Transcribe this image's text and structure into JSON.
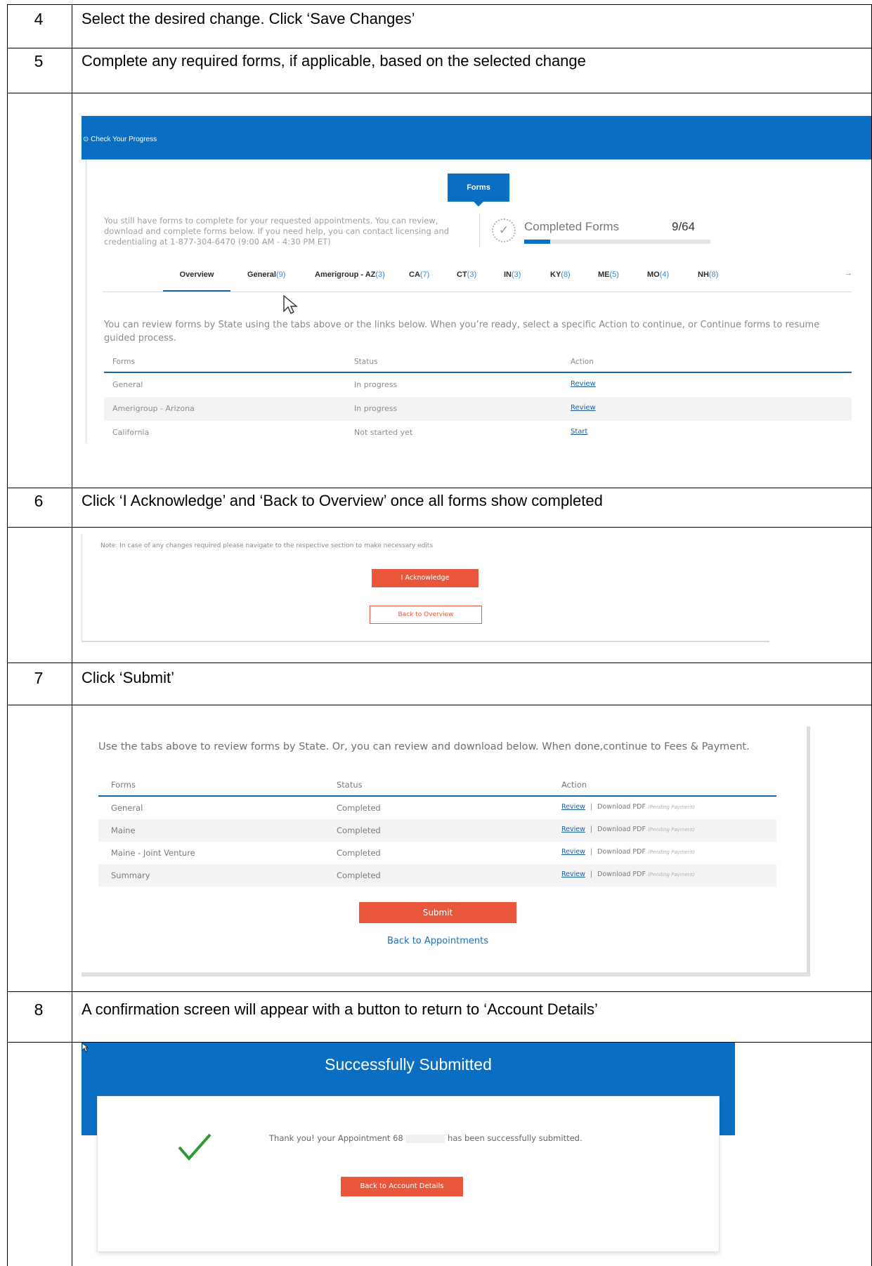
{
  "steps": [
    {
      "number": "4",
      "text": "Select the desired change. Click ‘Save Changes’"
    },
    {
      "number": "5",
      "text": "Complete any required forms, if applicable, based on the selected change"
    },
    {
      "number": "6",
      "text": "Click ‘I Acknowledge’ and ‘Back to Overview’ once all forms show completed"
    },
    {
      "number": "7",
      "text": "Click ‘Submit’"
    },
    {
      "number": "8",
      "text": "A confirmation screen will appear with a button to return to ‘Account Details’"
    }
  ],
  "progress_screen": {
    "header_label": "Check Your Progress",
    "forms_badge": "Forms",
    "intro_text": "You still have forms to complete for your requested appointments. You can review, download and complete forms below. If you need help, you can contact licensing and credentialing at 1-877-304-6470 (9:00 AM - 4:30 PM ET)",
    "completed_label": "Completed Forms",
    "completed_count": "9/64",
    "completed_fraction": 0.14,
    "tabs": [
      {
        "label": "Overview",
        "count": ""
      },
      {
        "label": "General",
        "count": "(9)"
      },
      {
        "label": "Amerigroup - AZ",
        "count": "(3)"
      },
      {
        "label": "CA",
        "count": "(7)"
      },
      {
        "label": "CT",
        "count": "(3)"
      },
      {
        "label": "IN",
        "count": "(3)"
      },
      {
        "label": "KY",
        "count": "(8)"
      },
      {
        "label": "ME",
        "count": "(5)"
      },
      {
        "label": "MO",
        "count": "(4)"
      },
      {
        "label": "NH",
        "count": "(8)"
      }
    ],
    "tabs_next_arrow": "→",
    "review_text": "You can review forms by State using the tabs above or the links below. When you’re ready, select a specific Action to continue, or Continue forms to resume guided process.",
    "columns": {
      "forms": "Forms",
      "status": "Status",
      "action": "Action"
    },
    "rows": [
      {
        "form": "General",
        "status": "In progress",
        "action": "Review"
      },
      {
        "form": "Amerigroup - Arizona",
        "status": "In progress",
        "action": "Review"
      },
      {
        "form": "California",
        "status": "Not started yet",
        "action": "Start"
      }
    ]
  },
  "acknowledge_screen": {
    "note": "Note: In case of any changes required please navigate to the respective section to make necessary edits",
    "acknowledge_button": "I Acknowledge",
    "back_button": "Back to Overview"
  },
  "submit_screen": {
    "intro_text": "Use the tabs above to review forms by State. Or, you can review and download below. When done,continue to Fees & Payment.",
    "columns": {
      "forms": "Forms",
      "status": "Status",
      "action": "Action"
    },
    "rows": [
      {
        "form": "General",
        "status": "Completed",
        "review": "Review",
        "separator": "|",
        "download": "Download PDF",
        "note": "(Pending Payment)"
      },
      {
        "form": "Maine",
        "status": "Completed",
        "review": "Review",
        "separator": "|",
        "download": "Download PDF",
        "note": "(Pending Payment)"
      },
      {
        "form": "Maine - Joint Venture",
        "status": "Completed",
        "review": "Review",
        "separator": "|",
        "download": "Download PDF",
        "note": "(Pending Payment)"
      },
      {
        "form": "Summary",
        "status": "Completed",
        "review": "Review",
        "separator": "|",
        "download": "Download PDF",
        "note": "(Pending Payment)"
      }
    ],
    "submit_button": "Submit",
    "back_link": "Back to Appointments"
  },
  "confirmation_screen": {
    "title": "Successfully Submitted",
    "message_before": "Thank you! your Appointment 68",
    "message_after": "has been successfully submitted.",
    "back_button": "Back to Account Details"
  },
  "colors": {
    "brand_blue": "#0a6fc2",
    "accent_orange": "#e8573b",
    "success_green": "#2e9a36",
    "link_blue": "#1a5fa8"
  }
}
